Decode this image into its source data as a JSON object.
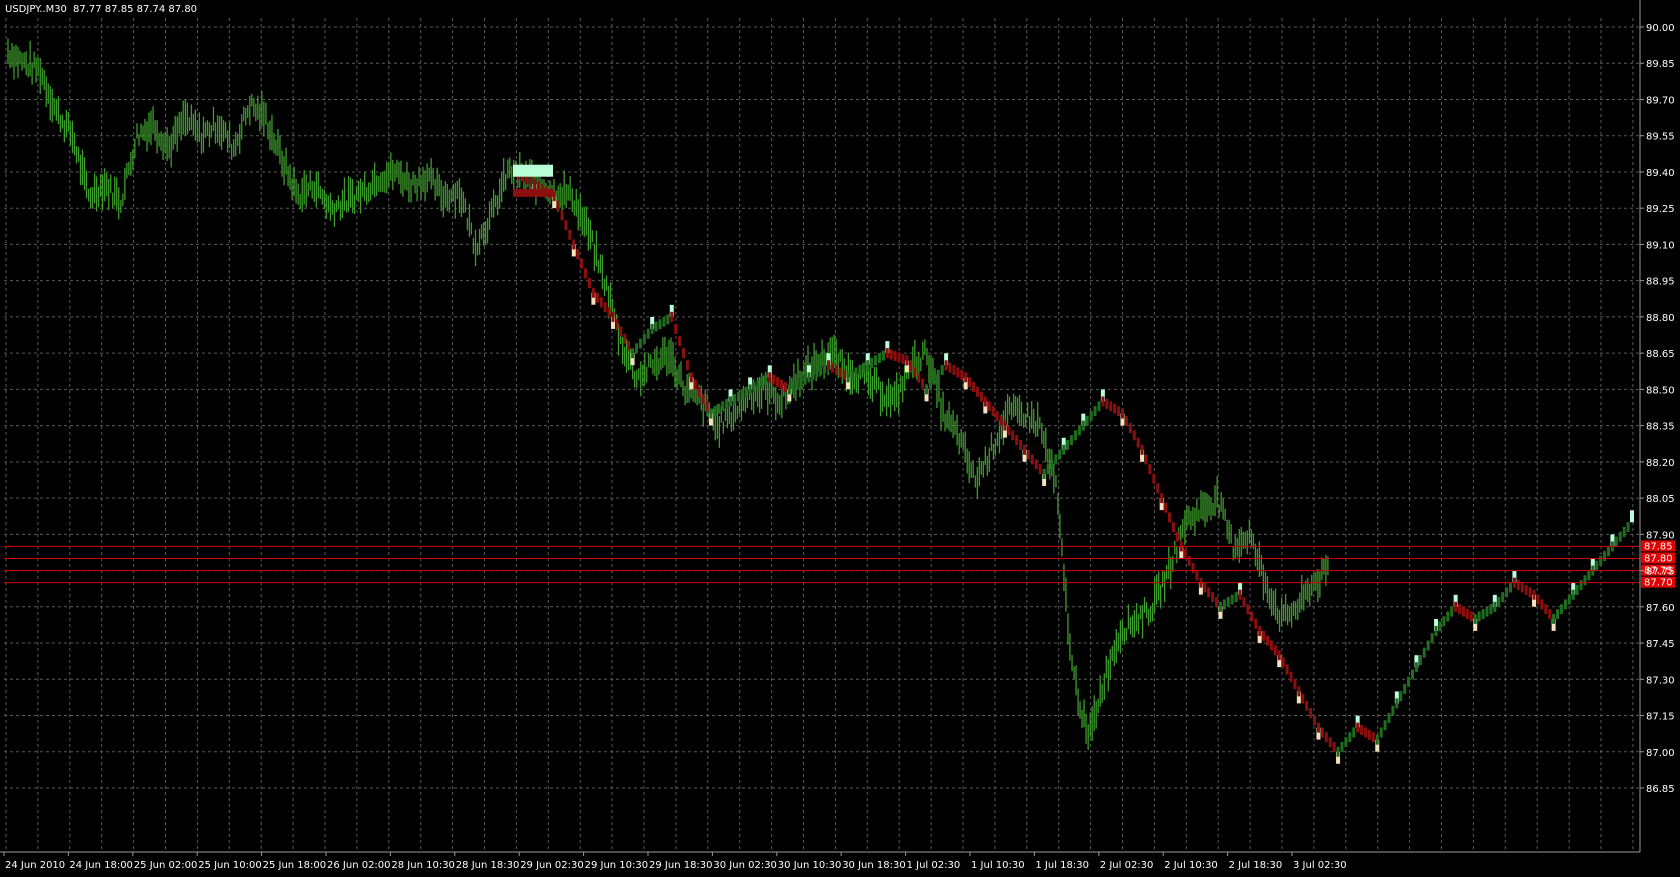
{
  "header": {
    "symbol_timeframe": "USDJPY..M30",
    "ohlc": "87.77 87.85 87.74 87.80"
  },
  "colors": {
    "background": "#000000",
    "grid": "#5a5a5a",
    "axis_line": "#9a9a9a",
    "text": "#ffffff",
    "bar_green": "#3d9c2c",
    "renko_up": "#1f6e1f",
    "renko_up_highlight": "#b8ffd8",
    "renko_down": "#8b0f0f",
    "renko_down_highlight": "#f5e1bd",
    "level_line": "#d40000",
    "level_label_bg": "#e00000"
  },
  "chart_data": {
    "type": "line",
    "title": "USDJPY..M30",
    "ylim": [
      86.8,
      90.05
    ],
    "y_ticks": [
      "90.00",
      "89.85",
      "89.70",
      "89.55",
      "89.40",
      "89.25",
      "89.10",
      "88.95",
      "88.80",
      "88.65",
      "88.50",
      "88.35",
      "88.20",
      "88.05",
      "87.90",
      "87.75",
      "87.60",
      "87.45",
      "87.30",
      "87.15",
      "87.00",
      "86.85"
    ],
    "x_ticks": [
      "24 Jun 2010",
      "24 Jun 18:00",
      "25 Jun 02:00",
      "25 Jun 10:00",
      "25 Jun 18:00",
      "26 Jun 02:00",
      "28 Jun 10:30",
      "28 Jun 18:30",
      "29 Jun 02:30",
      "29 Jun 10:30",
      "29 Jun 18:30",
      "30 Jun 02:30",
      "30 Jun 10:30",
      "30 Jun 18:30",
      "1 Jul 02:30",
      "1 Jul 10:30",
      "1 Jul 18:30",
      "2 Jul 02:30",
      "2 Jul 10:30",
      "2 Jul 18:30",
      "3 Jul 02:30"
    ],
    "grid": true,
    "horizontal_levels": [
      {
        "value": 87.85,
        "label": "87.85"
      },
      {
        "value": 87.8,
        "label": "87.80"
      },
      {
        "value": 87.75,
        "label": "87.75"
      },
      {
        "value": 87.7,
        "label": "87.70"
      }
    ],
    "series": [
      {
        "kind": "price_bars",
        "values": [
          89.9,
          89.85,
          89.82,
          89.65,
          89.55,
          89.3,
          89.35,
          89.28,
          89.55,
          89.6,
          89.5,
          89.62,
          89.55,
          89.6,
          89.5,
          89.68,
          89.62,
          89.45,
          89.3,
          89.35,
          89.25,
          89.28,
          89.32,
          89.38,
          89.4,
          89.35,
          89.38,
          89.3,
          89.32,
          89.1,
          89.22,
          89.4,
          89.38,
          89.35,
          89.32,
          89.3,
          89.15,
          88.95,
          88.7,
          88.55,
          88.6,
          88.65,
          88.5,
          88.45,
          88.35,
          88.4,
          88.48,
          88.5,
          88.45,
          88.55,
          88.6,
          88.65,
          88.58,
          88.55,
          88.5,
          88.45,
          88.6,
          88.65,
          88.4,
          88.3,
          88.12,
          88.25,
          88.4,
          88.4,
          88.35,
          88.1,
          87.35,
          87.05,
          87.3,
          87.5,
          87.55,
          87.6,
          87.75,
          87.95,
          88.0,
          88.05,
          87.85,
          87.9,
          87.7,
          87.55,
          87.6,
          87.7,
          87.75
        ]
      },
      {
        "kind": "renko_line",
        "values": [
          89.4,
          89.35,
          89.3,
          89.1,
          88.9,
          88.8,
          88.65,
          88.75,
          88.8,
          88.55,
          88.4,
          88.45,
          88.5,
          88.55,
          88.5,
          88.55,
          88.6,
          88.55,
          88.6,
          88.65,
          88.62,
          88.5,
          88.6,
          88.55,
          88.45,
          88.35,
          88.25,
          88.15,
          88.25,
          88.35,
          88.45,
          88.4,
          88.25,
          88.05,
          87.85,
          87.7,
          87.6,
          87.65,
          87.5,
          87.4,
          87.25,
          87.1,
          87.0,
          87.1,
          87.05,
          87.2,
          87.35,
          87.5,
          87.6,
          87.55,
          87.6,
          87.7,
          87.65,
          87.55,
          87.65,
          87.75,
          87.85,
          87.95
        ]
      }
    ]
  }
}
